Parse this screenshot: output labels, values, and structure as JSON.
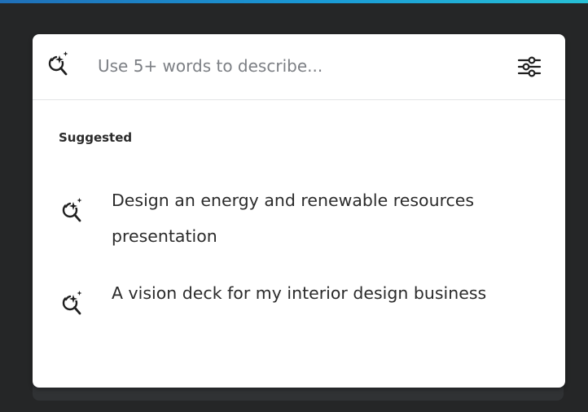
{
  "colors": {
    "background": "#252627",
    "card": "#ffffff",
    "accent": "#1a9ad6",
    "text": "#2b2b2b",
    "placeholder": "#7c7f84"
  },
  "search": {
    "icon": "magic-search-icon",
    "placeholder": "Use 5+ words to describe...",
    "value": "",
    "filter_icon": "sliders-icon"
  },
  "suggested": {
    "heading": "Suggested",
    "items": [
      {
        "icon": "magic-search-icon",
        "label": "Design an energy and renewable resources presentation"
      },
      {
        "icon": "magic-search-icon",
        "label": "A vision deck for my interior design business"
      }
    ]
  }
}
